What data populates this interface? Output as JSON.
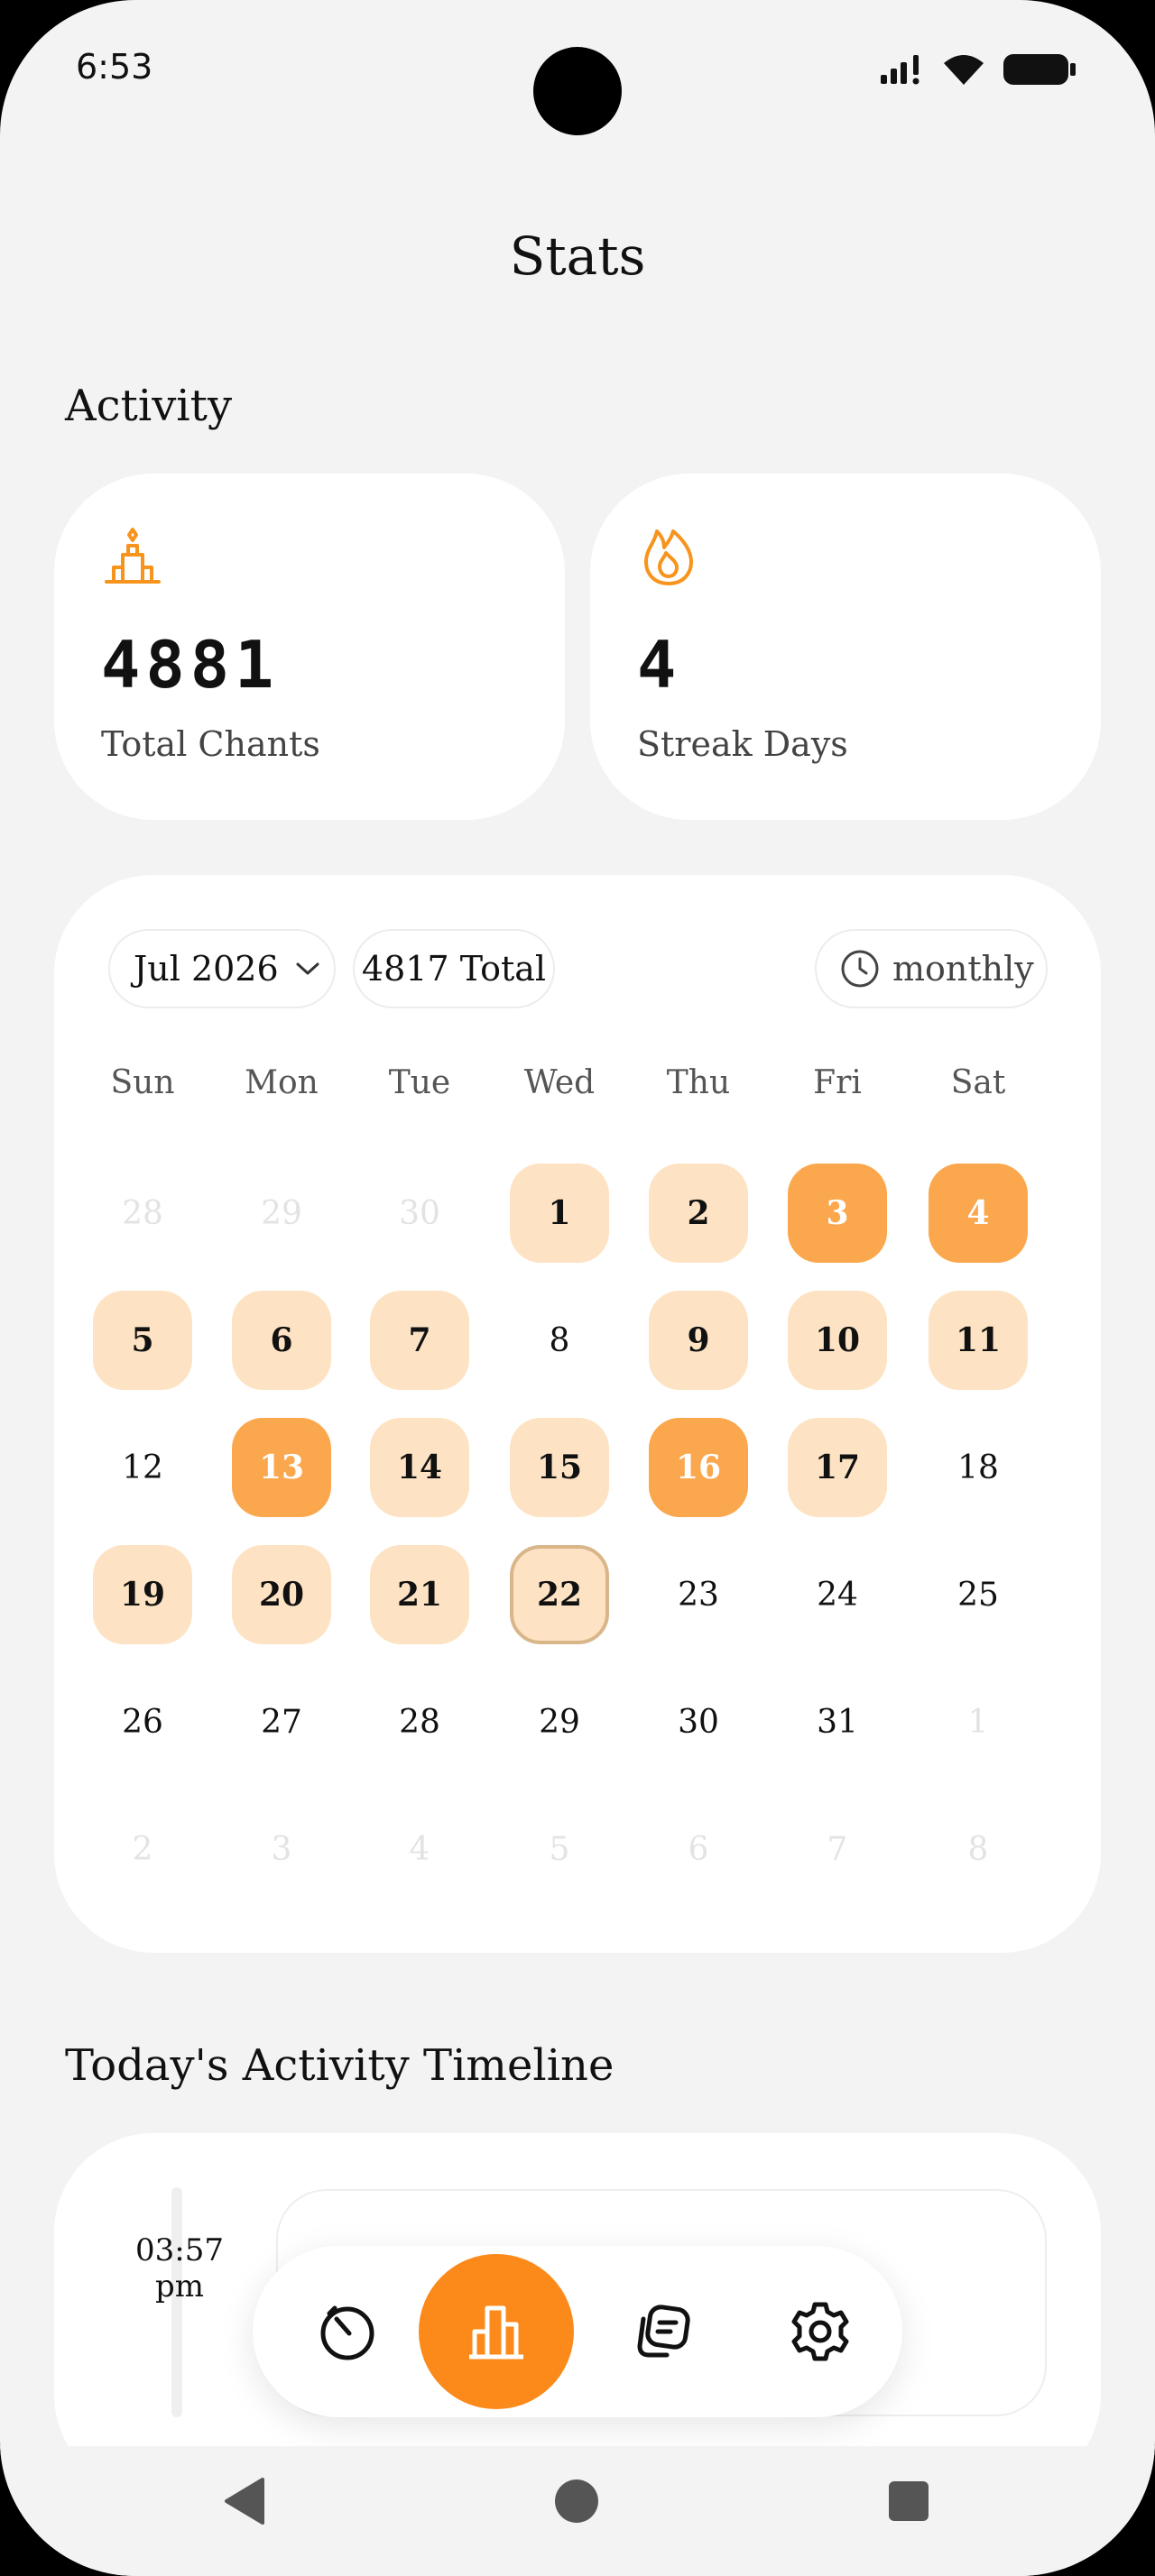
{
  "status_bar": {
    "time": "6:53"
  },
  "header": {
    "title": "Stats"
  },
  "activity": {
    "section_title": "Activity",
    "total_chants": {
      "value": "4881",
      "label": "Total Chants",
      "icon": "temple-icon"
    },
    "streak": {
      "value": "4",
      "label": "Streak Days",
      "icon": "flame-icon"
    }
  },
  "calendar": {
    "month_label": "Jul 2026",
    "total_label": "4817 Total",
    "mode_label": "monthly",
    "weekdays": [
      "Sun",
      "Mon",
      "Tue",
      "Wed",
      "Thu",
      "Fri",
      "Sat"
    ],
    "weeks": [
      [
        {
          "d": "28",
          "s": "faded"
        },
        {
          "d": "29",
          "s": "faded"
        },
        {
          "d": "30",
          "s": "faded"
        },
        {
          "d": "1",
          "s": "light"
        },
        {
          "d": "2",
          "s": "light"
        },
        {
          "d": "3",
          "s": "strong"
        },
        {
          "d": "4",
          "s": "strong"
        }
      ],
      [
        {
          "d": "5",
          "s": "light"
        },
        {
          "d": "6",
          "s": "light"
        },
        {
          "d": "7",
          "s": "light"
        },
        {
          "d": "8",
          "s": "none"
        },
        {
          "d": "9",
          "s": "light"
        },
        {
          "d": "10",
          "s": "light"
        },
        {
          "d": "11",
          "s": "light"
        }
      ],
      [
        {
          "d": "12",
          "s": "none"
        },
        {
          "d": "13",
          "s": "strong"
        },
        {
          "d": "14",
          "s": "light"
        },
        {
          "d": "15",
          "s": "light"
        },
        {
          "d": "16",
          "s": "strong"
        },
        {
          "d": "17",
          "s": "light"
        },
        {
          "d": "18",
          "s": "none"
        }
      ],
      [
        {
          "d": "19",
          "s": "light"
        },
        {
          "d": "20",
          "s": "light"
        },
        {
          "d": "21",
          "s": "light"
        },
        {
          "d": "22",
          "s": "today"
        },
        {
          "d": "23",
          "s": "none"
        },
        {
          "d": "24",
          "s": "none"
        },
        {
          "d": "25",
          "s": "none"
        }
      ],
      [
        {
          "d": "26",
          "s": "none"
        },
        {
          "d": "27",
          "s": "none"
        },
        {
          "d": "28",
          "s": "none"
        },
        {
          "d": "29",
          "s": "none"
        },
        {
          "d": "30",
          "s": "none"
        },
        {
          "d": "31",
          "s": "none"
        },
        {
          "d": "1",
          "s": "faded"
        }
      ],
      [
        {
          "d": "2",
          "s": "faded"
        },
        {
          "d": "3",
          "s": "faded"
        },
        {
          "d": "4",
          "s": "faded"
        },
        {
          "d": "5",
          "s": "faded"
        },
        {
          "d": "6",
          "s": "faded"
        },
        {
          "d": "7",
          "s": "faded"
        },
        {
          "d": "8",
          "s": "faded"
        }
      ]
    ]
  },
  "timeline": {
    "section_title": "Today's Activity Timeline",
    "entries": [
      {
        "time": "03:57",
        "period": "pm"
      }
    ]
  },
  "nav": {
    "items": [
      {
        "name": "timer",
        "icon": "timer-icon",
        "active": false
      },
      {
        "name": "stats",
        "icon": "bar-chart-icon",
        "active": true
      },
      {
        "name": "notes",
        "icon": "notes-icon",
        "active": false
      },
      {
        "name": "settings",
        "icon": "gear-icon",
        "active": false
      }
    ]
  },
  "colors": {
    "accent": "#fb8a1b",
    "day_light": "#fde3c3",
    "day_strong": "#fba74d",
    "background": "#f3f3f3"
  }
}
